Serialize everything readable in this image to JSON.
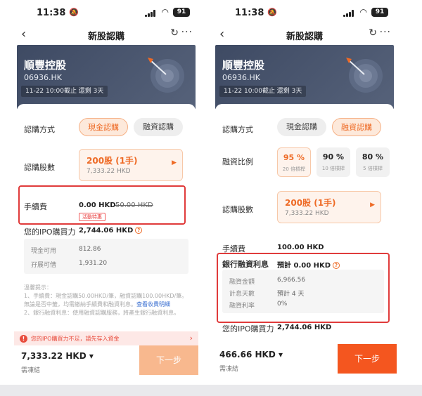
{
  "status": {
    "time": "11:38",
    "battery": "91"
  },
  "nav": {
    "title": "新股認購"
  },
  "banner": {
    "name": "順豐控股",
    "code": "06936.HK",
    "deadline": "11-22 10:00截止 還剩 3天"
  },
  "left": {
    "method_label": "認購方式",
    "methods": [
      "現金認購",
      "融資認購"
    ],
    "shares_label": "認購股數",
    "lot_main": "200股 (1手)",
    "lot_sub": "7,333.22 HKD",
    "fee_label": "手續費",
    "fee_value": "0.00 HKD",
    "fee_original": "50.00 HKD",
    "fee_tag": "活動特惠",
    "power_label": "您的IPO購買力",
    "power_value": "2,744.06 HKD",
    "cash_label": "現金可用",
    "cash_value": "812.86",
    "pending_label": "孖展可借",
    "pending_value": "1,931.20",
    "tips_title": "溫馨提示：",
    "tips_1": "1、手續費：現金認購50.00HKD/筆，融資認購100.00HKD/筆。無論是否中籤，均需繳納手續費和融資利息。",
    "tips_link": "查看收費明細",
    "tips_2": "2、銀行融資利息：使用融資認購服務，將產生銀行融資利息。",
    "warn": "您的IPO購買力不足，請先存入資金",
    "footer_amount": "7,333.22 HKD",
    "footer_sub": "需凍結",
    "next": "下一步"
  },
  "right": {
    "method_label": "認購方式",
    "methods": [
      "現金認購",
      "融資認購"
    ],
    "ratio_label": "融資比例",
    "ratios": [
      {
        "pct": "95 %",
        "sub": "20 倍槓桿"
      },
      {
        "pct": "90 %",
        "sub": "10 倍槓桿"
      },
      {
        "pct": "80 %",
        "sub": "5 倍槓桿"
      }
    ],
    "shares_label": "認購股數",
    "lot_main": "200股 (1手)",
    "lot_sub": "7,333.22 HKD",
    "fee_label": "手續費",
    "fee_value": "100.00 HKD",
    "interest_label": "銀行融資利息",
    "interest_value": "預計 0.00 HKD",
    "loan_label": "融資金額",
    "loan_value": "6,966.56",
    "days_label": "計息天數",
    "days_value": "預計 4 天",
    "rate_label": "融資利率",
    "rate_value": "0%",
    "power_label": "您的IPO購買力",
    "power_value": "2,744.06 HKD",
    "footer_amount": "466.66 HKD",
    "footer_sub": "需凍結",
    "next": "下一步"
  },
  "colors": {
    "accent": "#ee6a25",
    "highlight": "#e03b3b",
    "banner": "#46526b"
  }
}
